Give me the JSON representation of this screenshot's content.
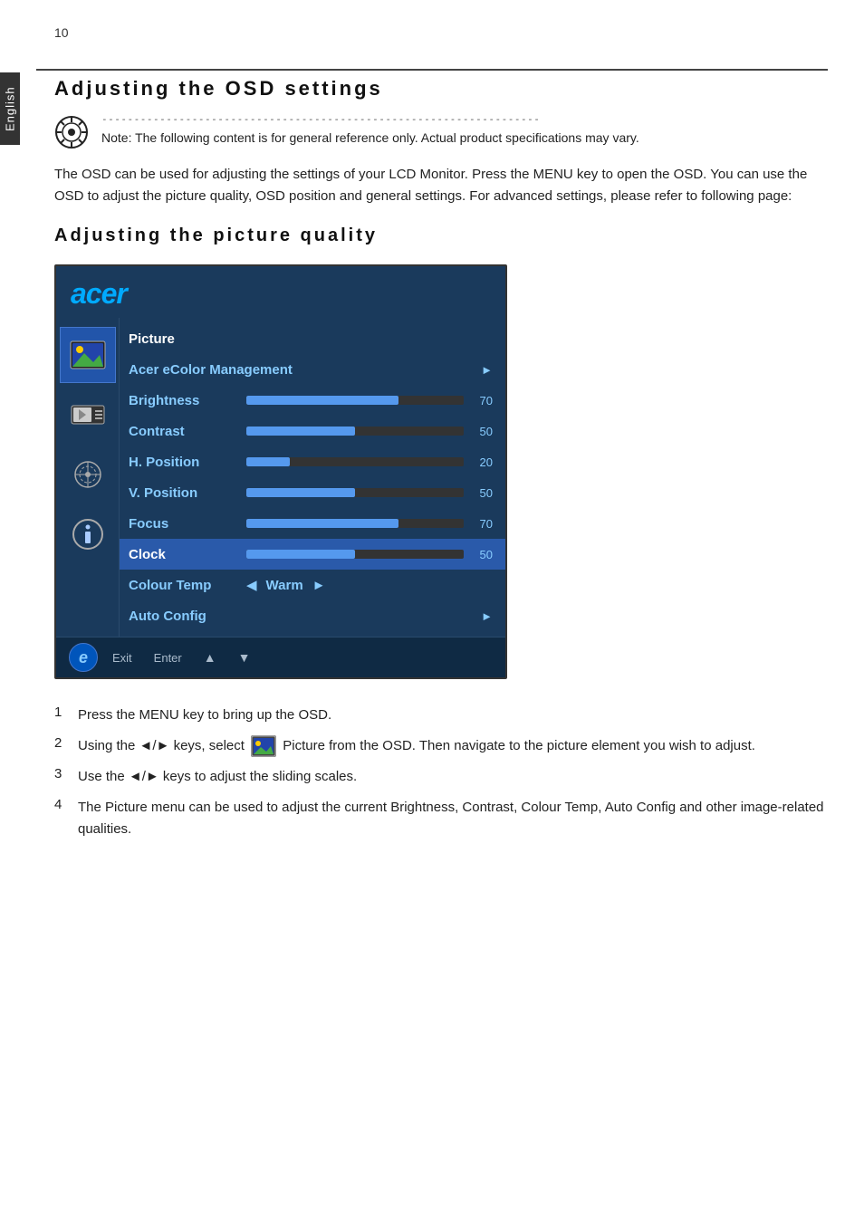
{
  "page": {
    "number": "10",
    "side_tab": "English",
    "section_title": "Adjusting the OSD settings",
    "note_dashes": "--------------------------------------------------------------------",
    "note_text": "Note: The following content is for general reference only. Actual product specifications may vary.",
    "body_text": "The OSD can be used for adjusting the settings of your LCD Monitor. Press the MENU key to open the OSD. You can use the OSD to adjust the picture quality, OSD position and general settings. For advanced settings, please refer to following page:",
    "sub_section_title": "Adjusting the picture quality",
    "osd": {
      "logo": "acer",
      "menu_items": [
        {
          "label": "Picture",
          "type": "header"
        },
        {
          "label": "Acer eColor Management",
          "type": "arrow"
        },
        {
          "label": "Brightness",
          "type": "slider",
          "value": 70,
          "fill_pct": 70
        },
        {
          "label": "Contrast",
          "type": "slider",
          "value": 50,
          "fill_pct": 50
        },
        {
          "label": "H. Position",
          "type": "slider",
          "value": 20,
          "fill_pct": 20
        },
        {
          "label": "V. Position",
          "type": "slider",
          "value": 50,
          "fill_pct": 50
        },
        {
          "label": "Focus",
          "type": "slider",
          "value": 70,
          "fill_pct": 70
        },
        {
          "label": "Clock",
          "type": "slider",
          "value": 50,
          "fill_pct": 50
        },
        {
          "label": "Colour Temp",
          "type": "colour_temp",
          "value": "Warm"
        },
        {
          "label": "Auto Config",
          "type": "arrow"
        }
      ],
      "footer": {
        "logo_char": "e",
        "items": [
          "Exit",
          "Enter",
          "▲",
          "▼"
        ]
      }
    },
    "instructions": [
      {
        "num": "1",
        "text": "Press the MENU key to bring up the OSD."
      },
      {
        "num": "2",
        "text": "Using the ◄/► keys, select [Picture icon] Picture from the OSD. Then navigate to the picture element you wish to adjust."
      },
      {
        "num": "3",
        "text": "Use the ◄/► keys to adjust the sliding scales."
      },
      {
        "num": "4",
        "text": "The Picture menu can be used to adjust the current Brightness, Contrast, Colour Temp, Auto Config and other image-related qualities."
      }
    ]
  }
}
